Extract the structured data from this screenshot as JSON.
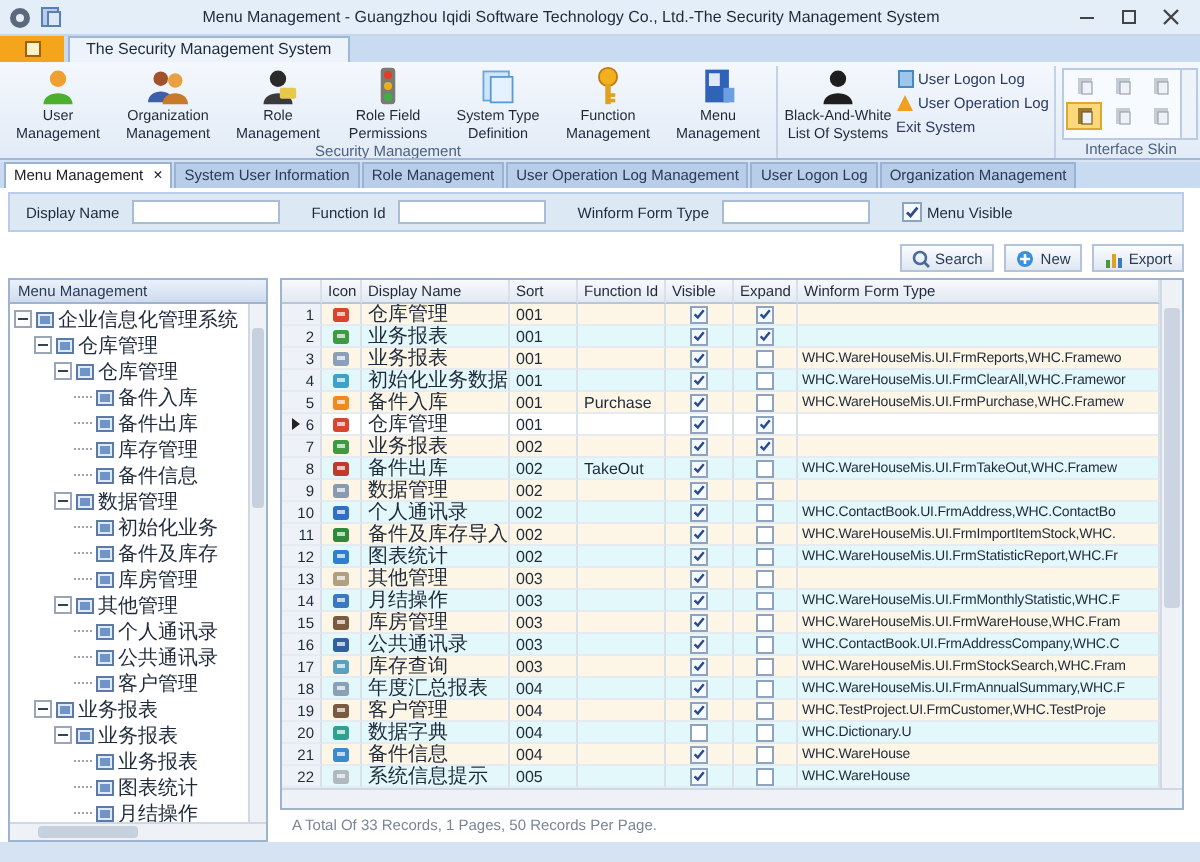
{
  "window": {
    "title": "Menu Management - Guangzhou Iqidi Software Technology Co., Ltd.-The Security Management System"
  },
  "ribbon": {
    "tabs": [
      {
        "label": "The Security Management System",
        "selected": true
      }
    ],
    "groups": [
      {
        "kind": "buttons",
        "label": "Security Management",
        "large_buttons": [
          "User Management",
          "Organization Management",
          "Role Management",
          "Role Field Permissions",
          "System Type Definition",
          "Function Management",
          "Menu Management"
        ]
      },
      {
        "kind": "buttons",
        "large_buttons": [
          "Black-And-White List Of Systems"
        ],
        "small_buttons": [
          "User Logon Log",
          "User Operation Log",
          "Exit System"
        ]
      },
      {
        "kind": "skins",
        "label": "Interface Skin",
        "skins": [
          {
            "selected": false
          },
          {
            "selected": false
          },
          {
            "selected": false
          },
          {
            "selected": true
          },
          {
            "selected": false
          },
          {
            "selected": false
          }
        ]
      }
    ]
  },
  "document_tabs": [
    {
      "label": "Menu Management",
      "selected": true,
      "close": "×"
    },
    {
      "label": "System User Information",
      "selected": false
    },
    {
      "label": "Role Management",
      "selected": false
    },
    {
      "label": "User Operation Log Management",
      "selected": false
    },
    {
      "label": "User Logon Log",
      "selected": false
    },
    {
      "label": "Organization Management",
      "selected": false
    }
  ],
  "filters": {
    "fields": [
      {
        "label": "Display Name"
      },
      {
        "label": "Function Id"
      },
      {
        "label": "Winform Form Type"
      }
    ],
    "menu_visible": {
      "label": "Menu Visible",
      "checked": true
    }
  },
  "actions": [
    "Search",
    "New",
    "Export"
  ],
  "tree": {
    "title": "Menu Management",
    "items": [
      {
        "label": "企业信息化管理系统",
        "expanded": true,
        "children": [
          {
            "label": "仓库管理",
            "expanded": true,
            "children": [
              {
                "label": "仓库管理",
                "expanded": true,
                "children": [
                  {
                    "label": "备件入库"
                  },
                  {
                    "label": "备件出库"
                  },
                  {
                    "label": "库存管理"
                  },
                  {
                    "label": "备件信息"
                  }
                ]
              },
              {
                "label": "数据管理",
                "expanded": true,
                "children": [
                  {
                    "label": "初始化业务"
                  },
                  {
                    "label": "备件及库存"
                  },
                  {
                    "label": "库房管理"
                  }
                ]
              },
              {
                "label": "其他管理",
                "expanded": true,
                "children": [
                  {
                    "label": "个人通讯录"
                  },
                  {
                    "label": "公共通讯录"
                  },
                  {
                    "label": "客户管理"
                  }
                ]
              }
            ]
          },
          {
            "label": "业务报表",
            "expanded": true,
            "children": [
              {
                "label": "业务报表",
                "expanded": true,
                "children": [
                  {
                    "label": "业务报表"
                  },
                  {
                    "label": "图表统计"
                  },
                  {
                    "label": "月结操作"
                  }
                ]
              }
            ]
          }
        ]
      }
    ]
  },
  "grid": {
    "columns": [
      "Icon",
      "Display Name",
      "Sort",
      "Function Id",
      "Visible",
      "Expand",
      "Winform Form Type"
    ],
    "rows": [
      {
        "number": "1",
        "name": "仓库管理",
        "sort": "001",
        "visible": true,
        "expand": true,
        "selected": false
      },
      {
        "number": "2",
        "name": "业务报表",
        "sort": "001",
        "visible": true,
        "expand": true,
        "selected": false
      },
      {
        "number": "3",
        "name": "业务报表",
        "sort": "001",
        "visible": true,
        "expand": false,
        "selected": false,
        "form_type": "WHC.WareHouseMis.UI.FrmReports,WHC.Framewo"
      },
      {
        "number": "4",
        "name": "初始化业务数据",
        "sort": "001",
        "visible": true,
        "expand": false,
        "selected": false,
        "form_type": "WHC.WareHouseMis.UI.FrmClearAll,WHC.Framewor"
      },
      {
        "number": "5",
        "name": "备件入库",
        "sort": "001",
        "function_id": "Purchase",
        "visible": true,
        "expand": false,
        "selected": false,
        "form_type": "WHC.WareHouseMis.UI.FrmPurchase,WHC.Framew"
      },
      {
        "number": "6",
        "name": "仓库管理",
        "sort": "001",
        "visible": true,
        "expand": true,
        "selected": true
      },
      {
        "number": "7",
        "name": "业务报表",
        "sort": "002",
        "visible": true,
        "expand": true,
        "selected": false
      },
      {
        "number": "8",
        "name": "备件出库",
        "sort": "002",
        "function_id": "TakeOut",
        "visible": true,
        "expand": false,
        "selected": false,
        "form_type": "WHC.WareHouseMis.UI.FrmTakeOut,WHC.Framew"
      },
      {
        "number": "9",
        "name": "数据管理",
        "sort": "002",
        "visible": true,
        "expand": false,
        "selected": false
      },
      {
        "number": "10",
        "name": "个人通讯录",
        "sort": "002",
        "visible": true,
        "expand": false,
        "selected": false,
        "form_type": "WHC.ContactBook.UI.FrmAddress,WHC.ContactBo"
      },
      {
        "number": "11",
        "name": "备件及库存导入",
        "sort": "002",
        "visible": true,
        "expand": false,
        "selected": false,
        "form_type": "WHC.WareHouseMis.UI.FrmImportItemStock,WHC."
      },
      {
        "number": "12",
        "name": "图表统计",
        "sort": "002",
        "visible": true,
        "expand": false,
        "selected": false,
        "form_type": "WHC.WareHouseMis.UI.FrmStatisticReport,WHC.Fr"
      },
      {
        "number": "13",
        "name": "其他管理",
        "sort": "003",
        "visible": true,
        "expand": false,
        "selected": false
      },
      {
        "number": "14",
        "name": "月结操作",
        "sort": "003",
        "visible": true,
        "expand": false,
        "selected": false,
        "form_type": "WHC.WareHouseMis.UI.FrmMonthlyStatistic,WHC.F"
      },
      {
        "number": "15",
        "name": "库房管理",
        "sort": "003",
        "visible": true,
        "expand": false,
        "selected": false,
        "form_type": "WHC.WareHouseMis.UI.FrmWareHouse,WHC.Fram"
      },
      {
        "number": "16",
        "name": "公共通讯录",
        "sort": "003",
        "visible": true,
        "expand": false,
        "selected": false,
        "form_type": "WHC.ContactBook.UI.FrmAddressCompany,WHC.C"
      },
      {
        "number": "17",
        "name": "库存查询",
        "sort": "003",
        "visible": true,
        "expand": false,
        "selected": false,
        "form_type": "WHC.WareHouseMis.UI.FrmStockSearch,WHC.Fram"
      },
      {
        "number": "18",
        "name": "年度汇总报表",
        "sort": "004",
        "visible": true,
        "expand": false,
        "selected": false,
        "form_type": "WHC.WareHouseMis.UI.FrmAnnualSummary,WHC.F"
      },
      {
        "number": "19",
        "name": "客户管理",
        "sort": "004",
        "visible": true,
        "expand": false,
        "selected": false,
        "form_type": "WHC.TestProject.UI.FrmCustomer,WHC.TestProje"
      },
      {
        "number": "20",
        "name": "数据字典",
        "sort": "004",
        "visible": false,
        "expand": false,
        "selected": false,
        "form_type": "WHC.Dictionary.U"
      },
      {
        "number": "21",
        "name": "备件信息",
        "sort": "004",
        "visible": true,
        "expand": false,
        "selected": false,
        "form_type": "WHC.WareHouse"
      },
      {
        "number": "22",
        "name": "系统信息提示",
        "sort": "005",
        "visible": true,
        "expand": false,
        "selected": false,
        "form_type": "WHC.WareHouse"
      }
    ]
  },
  "status_bar": "A Total Of 33 Records, 1 Pages, 50 Records Per Page."
}
